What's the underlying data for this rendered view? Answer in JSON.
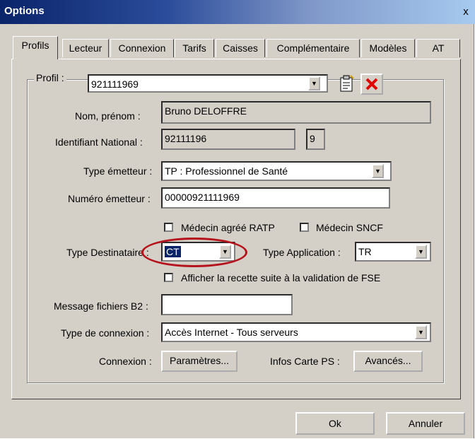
{
  "window": {
    "title": "Options",
    "close_glyph": "x"
  },
  "tabs": [
    "Profils",
    "Lecteur",
    "Connexion",
    "Tarifs",
    "Caisses",
    "Complémentaire",
    "Modèles",
    "AT"
  ],
  "profil": {
    "label": "Profil :",
    "value": "921111969"
  },
  "fields": {
    "nom_label": "Nom, prénom :",
    "nom_value": "Bruno DELOFFRE",
    "id_label": "Identifiant National :",
    "id_value": "92111196",
    "id_key": "9",
    "type_emetteur_label": "Type émetteur :",
    "type_emetteur_value": "TP : Professionnel de Santé",
    "numero_label": "Numéro émetteur :",
    "numero_value": "00000921111969",
    "ratp_label": "Médecin agréé RATP",
    "sncf_label": "Médecin SNCF",
    "type_dest_label": "Type Destinataire :",
    "type_dest_value": "CT",
    "type_app_label": "Type Application :",
    "type_app_value": "TR",
    "recette_label": "Afficher la recette suite à la validation de FSE",
    "b2_label": "Message fichiers B2 :",
    "b2_value": "",
    "connexion_type_label": "Type de connexion :",
    "connexion_type_value": "Accès Internet - Tous serveurs",
    "connexion_label": "Connexion :",
    "parametres_btn": "Paramètres...",
    "infos_label": "Infos Carte PS :",
    "avances_btn": "Avancés..."
  },
  "footer": {
    "ok": "Ok",
    "annuler": "Annuler"
  },
  "colors": {
    "highlight": "#b5121b",
    "selection": "#0a246a",
    "delete_icon": "#e00000"
  }
}
